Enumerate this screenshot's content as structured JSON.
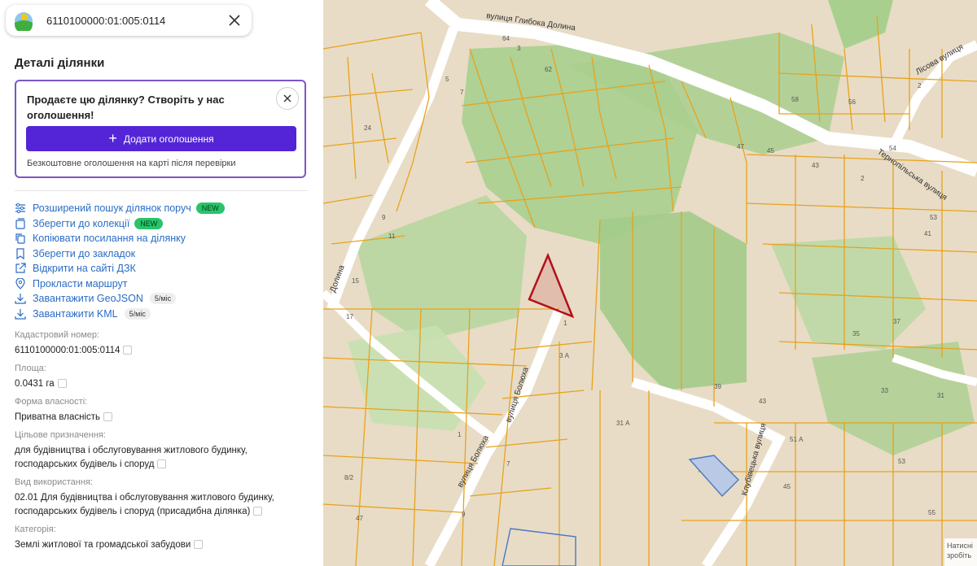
{
  "search": {
    "value": "6110100000:01:005:0114"
  },
  "details_title": "Деталі ділянки",
  "promo": {
    "text": "Продаєте цю ділянку? Створіть у нас оголошення!",
    "button_label": "Додати оголошення",
    "note": "Безкоштовне оголошення на карті після перевірки"
  },
  "actions": [
    {
      "label": "Розширений пошук ділянок поруч",
      "badge": "NEW",
      "icon": "sliders-icon"
    },
    {
      "label": "Зберегти до колекції",
      "badge": "NEW",
      "icon": "collection-icon"
    },
    {
      "label": "Копіювати посилання на ділянку",
      "icon": "copy-icon"
    },
    {
      "label": "Зберегти до закладок",
      "icon": "bookmark-icon"
    },
    {
      "label": "Відкрити на сайті ДЗК",
      "icon": "external-link-icon"
    },
    {
      "label": "Прокласти маршрут",
      "icon": "location-pin-icon"
    },
    {
      "label": "Завантажити GeoJSON",
      "limit": "5/міс",
      "icon": "download-icon"
    },
    {
      "label": "Завантажити KML",
      "limit": "5/міс",
      "icon": "download-icon"
    }
  ],
  "info": [
    {
      "label": "Кадастровий номер:",
      "value": "6110100000:01:005:0114"
    },
    {
      "label": "Площа:",
      "value": "0.0431 га"
    },
    {
      "label": "Форма власності:",
      "value": "Приватна власність"
    },
    {
      "label": "Цільове призначення:",
      "value": "для будівництва і обслуговування житлового будинку, господарських будівель і споруд"
    },
    {
      "label": "Вид використання:",
      "value": "02.01 Для будівництва і обслуговування житлового будинку, господарських будівель і споруд (присадибна ділянка)"
    },
    {
      "label": "Категорія:",
      "value": "Землі житлової та громадської забудови"
    }
  ],
  "map": {
    "streets": [
      "вулиця Глибока Долина",
      "Лісова вулиця",
      "Тернопільська вулиця",
      "вулиця Болюха",
      "вулиця Болюха",
      "Клубівецька вулиця",
      "Долина"
    ],
    "house_numbers": [
      "64",
      "62",
      "58",
      "56",
      "2",
      "54",
      "47",
      "45",
      "43",
      "2",
      "53",
      "41",
      "3",
      "24",
      "5",
      "7",
      "9",
      "11",
      "15",
      "17",
      "3 А",
      "1",
      "37",
      "35",
      "33",
      "31",
      "43",
      "31 А",
      "39",
      "51 А",
      "45",
      "53",
      "55",
      "7",
      "1",
      "8/2",
      "9",
      "47"
    ],
    "attribution": "Натисні зробіть"
  },
  "colors": {
    "accent": "#5325d6",
    "link": "#2a6cc5",
    "badge_new": "#27c46a",
    "parcel_outline": "#e8a21a",
    "selected_parcel": "#b3101a",
    "promo_border": "#7a56c8"
  }
}
